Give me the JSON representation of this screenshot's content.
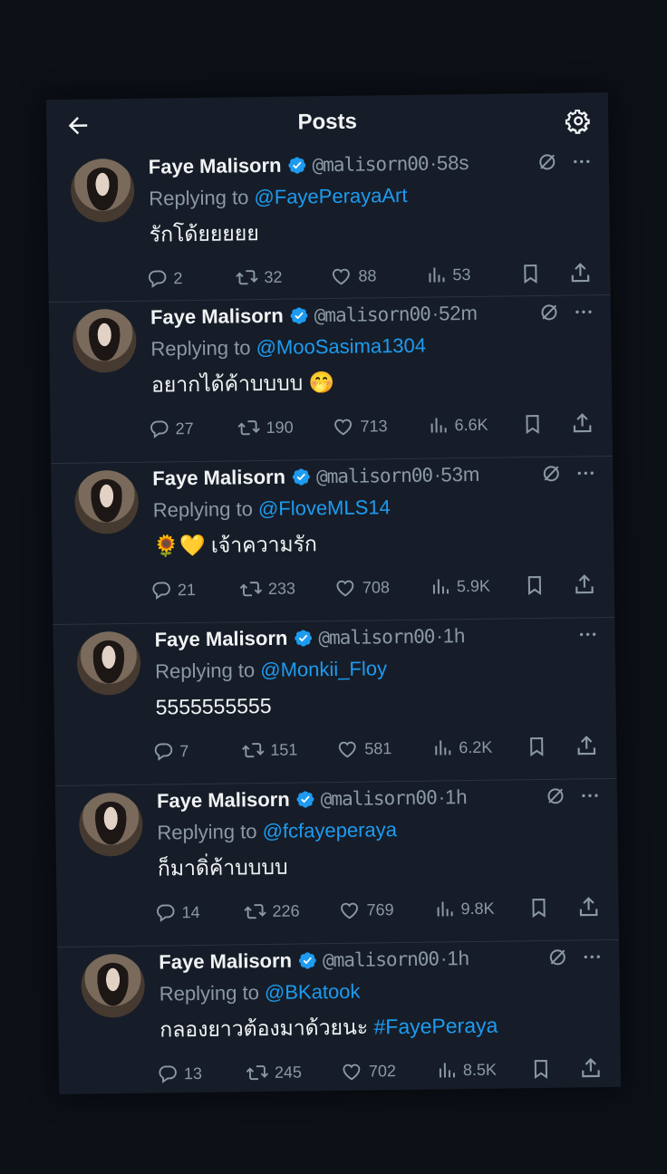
{
  "header": {
    "title": "Posts"
  },
  "posts": [
    {
      "name": "Faye Malisorn",
      "handle": "@malisorn00",
      "time": "58s",
      "replying_prefix": "Replying to ",
      "replying_to": "@FayePerayaArt",
      "text": "รักโด้ยยยยย",
      "hashtag": "",
      "show_grok": true,
      "replies": "2",
      "reposts": "32",
      "likes": "88",
      "views": "53"
    },
    {
      "name": "Faye Malisorn",
      "handle": "@malisorn00",
      "time": "52m",
      "replying_prefix": "Replying to ",
      "replying_to": "@MooSasima1304",
      "text": "อยากได้ค้าบบบบ 🤭",
      "hashtag": "",
      "show_grok": true,
      "replies": "27",
      "reposts": "190",
      "likes": "713",
      "views": "6.6K"
    },
    {
      "name": "Faye Malisorn",
      "handle": "@malisorn00",
      "time": "53m",
      "replying_prefix": "Replying to ",
      "replying_to": "@FloveMLS14",
      "text": "🌻💛 เจ้าความรัก",
      "hashtag": "",
      "show_grok": true,
      "replies": "21",
      "reposts": "233",
      "likes": "708",
      "views": "5.9K"
    },
    {
      "name": "Faye Malisorn",
      "handle": "@malisorn00",
      "time": "1h",
      "replying_prefix": "Replying to ",
      "replying_to": "@Monkii_Floy",
      "text": "5555555555",
      "hashtag": "",
      "show_grok": false,
      "replies": "7",
      "reposts": "151",
      "likes": "581",
      "views": "6.2K"
    },
    {
      "name": "Faye Malisorn",
      "handle": "@malisorn00",
      "time": "1h",
      "replying_prefix": "Replying to ",
      "replying_to": "@fcfayeperaya",
      "text": "ก็มาดิ่ค้าบบบบ",
      "hashtag": "",
      "show_grok": true,
      "replies": "14",
      "reposts": "226",
      "likes": "769",
      "views": "9.8K"
    },
    {
      "name": "Faye Malisorn",
      "handle": "@malisorn00",
      "time": "1h",
      "replying_prefix": "Replying to ",
      "replying_to": "@BKatook",
      "text": "กลองยาวต้องมาด้วยนะ ",
      "hashtag": "#FayePeraya",
      "show_grok": true,
      "replies": "13",
      "reposts": "245",
      "likes": "702",
      "views": "8.5K"
    }
  ],
  "icons": {
    "back": "arrow-left-icon",
    "settings": "gear-icon",
    "verified": "verified-badge-icon",
    "grok": "grok-icon",
    "more": "more-dots-icon",
    "reply": "reply-icon",
    "repost": "repost-icon",
    "like": "heart-icon",
    "views": "views-icon",
    "bookmark": "bookmark-icon",
    "share": "share-icon"
  },
  "colors": {
    "background": "#0c1017",
    "card": "#161d28",
    "accent": "#1d9bf0",
    "muted": "#8b98a5",
    "text": "#f1f3f4"
  }
}
